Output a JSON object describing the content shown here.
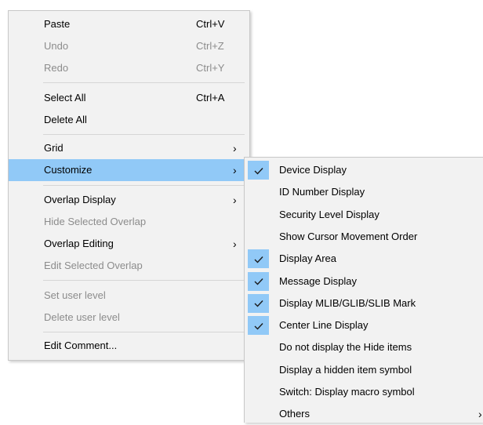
{
  "main_menu": {
    "paste": {
      "label": "Paste",
      "shortcut": "Ctrl+V"
    },
    "undo": {
      "label": "Undo",
      "shortcut": "Ctrl+Z"
    },
    "redo": {
      "label": "Redo",
      "shortcut": "Ctrl+Y"
    },
    "select_all": {
      "label": "Select All",
      "shortcut": "Ctrl+A"
    },
    "delete_all": {
      "label": "Delete All"
    },
    "grid": {
      "label": "Grid",
      "arrow": "›"
    },
    "customize": {
      "label": "Customize",
      "arrow": "›"
    },
    "overlap_display": {
      "label": "Overlap Display",
      "arrow": "›"
    },
    "hide_selected_overlap": {
      "label": "Hide Selected Overlap"
    },
    "overlap_editing": {
      "label": "Overlap Editing",
      "arrow": "›"
    },
    "edit_selected_overlap": {
      "label": "Edit Selected Overlap"
    },
    "set_user_level": {
      "label": "Set user level"
    },
    "delete_user_level": {
      "label": "Delete user level"
    },
    "edit_comment": {
      "label": "Edit Comment..."
    }
  },
  "sub_menu": {
    "items": [
      {
        "label": "Device Display",
        "checked": true
      },
      {
        "label": "ID Number Display",
        "checked": false
      },
      {
        "label": "Security Level Display",
        "checked": false
      },
      {
        "label": "Show Cursor Movement Order",
        "checked": false
      },
      {
        "label": "Display Area",
        "checked": true
      },
      {
        "label": "Message Display",
        "checked": true
      },
      {
        "label": "Display MLIB/GLIB/SLIB Mark",
        "checked": true
      },
      {
        "label": "Center Line Display",
        "checked": true
      },
      {
        "label": "Do not display the Hide items",
        "checked": false
      },
      {
        "label": "Display a hidden item symbol",
        "checked": false
      },
      {
        "label": "Switch: Display macro symbol",
        "checked": false
      },
      {
        "label": "Others",
        "checked": false,
        "arrow": "›"
      }
    ]
  },
  "colors": {
    "highlight": "#91c9f7",
    "menu_bg": "#f2f2f2",
    "disabled_text": "#8c8c8c"
  }
}
